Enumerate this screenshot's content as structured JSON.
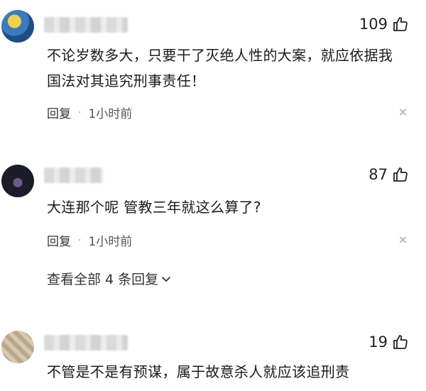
{
  "comments": [
    {
      "likes": "109",
      "text_line1": "不论岁数多大，只要干了灭绝人性的大案，就应依据我",
      "text_line2": "国法对其追究刑事责任！",
      "reply_label": "回复",
      "separator": "·",
      "time": "1小时前",
      "close": "×"
    },
    {
      "likes": "87",
      "text_line1": "大连那个呢 管教三年就这么算了?",
      "reply_label": "回复",
      "separator": "·",
      "time": "1小时前",
      "close": "×",
      "view_replies": "查看全部 4 条回复"
    },
    {
      "likes": "19",
      "text_line1": "不管是不是有预谋，属于故意杀人就应该追刑责"
    }
  ],
  "colors": {
    "avatar1_bg": "#2b6fb0",
    "avatar2_bg": "#1b1b2a",
    "avatar3_bg": "#c9b9a3"
  },
  "icons": [
    "thumbs-up-icon",
    "close-icon",
    "chevron-down-icon"
  ]
}
